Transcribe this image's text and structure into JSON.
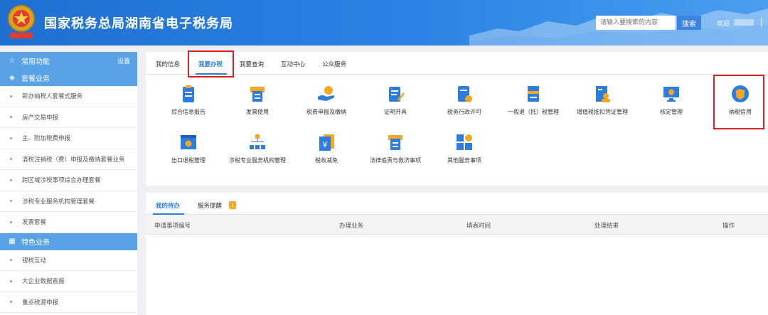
{
  "header": {
    "site_title": "国家税务总局湖南省电子税务局",
    "search_placeholder": "请输入要搜索的内容",
    "search_button": "搜索",
    "welcome": "欢迎"
  },
  "sidebar": {
    "common": {
      "label": "常用功能",
      "settings": "设置"
    },
    "package": {
      "label": "套餐业务",
      "items": [
        "新办纳税人套餐式服务",
        "房产交易申报",
        "主、附加税费申报",
        "清税注销税（费）申报及缴纳套餐业务",
        "跨区域涉税事项综合办理套餐",
        "涉税专业服务机构管理套餐",
        "发票套餐"
      ]
    },
    "special": {
      "label": "特色业务",
      "items": [
        "银税互动",
        "大企业数据直报",
        "重点税源申报"
      ]
    }
  },
  "tabs": [
    "我的信息",
    "我要办税",
    "我要查询",
    "互动中心",
    "公众服务"
  ],
  "active_tab": "我要办税",
  "services": [
    "综合信息报告",
    "发票使用",
    "税费申报及缴纳",
    "证明开具",
    "税务行政许可",
    "一般退（抵）税管理",
    "增值税抵扣凭证管理",
    "核定管理",
    "纳税信用",
    "出口退税管理",
    "涉税专业服务机构管理",
    "税收减免",
    "法律追责与救济事项",
    "其他服务事项"
  ],
  "bottom_tabs": {
    "todo": "我的待办",
    "reminder": "服务提醒",
    "reminder_count": "1"
  },
  "table_headers": [
    "申请事项编号",
    "办理业务",
    "填表时间",
    "处理结果",
    "操作"
  ],
  "colors": {
    "brand_blue": "#2b7de0",
    "highlight_red": "#e02020",
    "sidebar_head": "#5aa2e6"
  }
}
